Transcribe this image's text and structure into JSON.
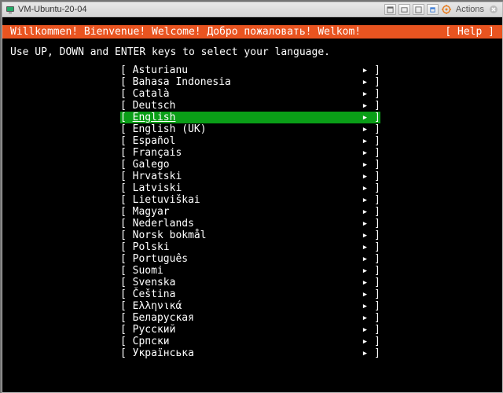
{
  "window": {
    "title": "VM-Ubuntu-20-04",
    "actions_label": "Actions"
  },
  "header": {
    "welcome": "Willkommen! Bienvenue! Welcome! Добро пожаловать! Welkom!",
    "help": "[ Help ]"
  },
  "prompt": "Use UP, DOWN and ENTER keys to select your language.",
  "open_bracket": "[ ",
  "arrow": "▸ ",
  "close_bracket": "]",
  "languages": [
    {
      "label": "Asturianu",
      "selected": false
    },
    {
      "label": "Bahasa Indonesia",
      "selected": false
    },
    {
      "label": "Català",
      "selected": false
    },
    {
      "label": "Deutsch",
      "selected": false
    },
    {
      "label": "English",
      "selected": true
    },
    {
      "label": "English (UK)",
      "selected": false
    },
    {
      "label": "Español",
      "selected": false
    },
    {
      "label": "Français",
      "selected": false
    },
    {
      "label": "Galego",
      "selected": false
    },
    {
      "label": "Hrvatski",
      "selected": false
    },
    {
      "label": "Latviski",
      "selected": false
    },
    {
      "label": "Lietuviškai",
      "selected": false
    },
    {
      "label": "Magyar",
      "selected": false
    },
    {
      "label": "Nederlands",
      "selected": false
    },
    {
      "label": "Norsk bokmål",
      "selected": false
    },
    {
      "label": "Polski",
      "selected": false
    },
    {
      "label": "Português",
      "selected": false
    },
    {
      "label": "Suomi",
      "selected": false
    },
    {
      "label": "Svenska",
      "selected": false
    },
    {
      "label": "Čeština",
      "selected": false
    },
    {
      "label": "Ελληνικά",
      "selected": false
    },
    {
      "label": "Беларуская",
      "selected": false
    },
    {
      "label": "Русский",
      "selected": false
    },
    {
      "label": "Српски",
      "selected": false
    },
    {
      "label": "Українська",
      "selected": false
    }
  ]
}
